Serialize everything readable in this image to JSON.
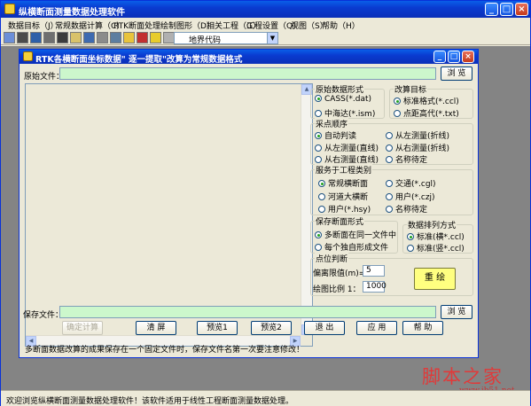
{
  "app": {
    "title": "纵横断面测量数据处理软件",
    "minimize": "_",
    "maximize": "□",
    "close": "×"
  },
  "menu": [
    "数据目标（J）",
    "常规数据计算（C）",
    "RTK断面处理",
    "绘制图形（D）",
    "相关工程（G）",
    "工程设置（Q）",
    "视图（S）",
    "帮助（H）"
  ],
  "toolbar": {
    "combo_value": "地界代码",
    "combo_arrow": "▼"
  },
  "dialog": {
    "title": "RTK各横断面坐标数据\" 逐一提取\"改算为常规数据格式",
    "minimize": "_",
    "maximize": "□",
    "close": "×",
    "source_label": "原始文件：",
    "source_value": "",
    "browse_label": "浏 览",
    "save_label": "保存文件：",
    "save_value": "",
    "browse2_label": "浏 览",
    "notice": "多断面数据改算的成果保存在一个固定文件时，保存文件名第一次要注意修改！",
    "groups": {
      "source_format": {
        "title": "原始数据形式",
        "options": [
          "CASS(*.dat)",
          "中海达(*.ism)"
        ],
        "selected": 0
      },
      "target": {
        "title": "改算目标",
        "options": [
          "标准格式(*.ccl)",
          "点距高代(*.txt)"
        ],
        "selected": 0
      },
      "order": {
        "title": "采点顺序",
        "options": [
          "自动判读",
          "从左测量(折线)",
          "从左测量(直线)",
          "从右测量(折线)",
          "从右测量(直线)",
          "名称待定"
        ],
        "selected": 0
      },
      "project": {
        "title": "服务于工程类别",
        "options": [
          "常规横断面",
          "交通(*.cgl)",
          "河道大横断",
          "用户(*.czj)",
          "用户(*.hsy)",
          "名称待定"
        ],
        "selected": 0
      },
      "save_form": {
        "title": "保存断面形式",
        "options": [
          "多断面在同一文件中",
          "每个独自形成文件"
        ],
        "selected": 0
      },
      "arrange": {
        "title": "数据排列方式",
        "options": [
          "标准(横*.ccl)",
          "标准(竖*.ccl)"
        ],
        "selected": 0
      },
      "judge": {
        "title": "点位判断",
        "offset_label": "偏离限值(m)=",
        "offset_value": "5",
        "scale_label": "绘图比例 1：",
        "scale_value": "1000",
        "redraw_label": "重 绘"
      }
    },
    "buttons": [
      "确定计算",
      "清 屏",
      "预览1",
      "预览2",
      "退 出",
      "应 用",
      "帮 助"
    ]
  },
  "status_bar": "欢迎浏览纵横断面测量数据处理软件！该软件适用于线性工程断面测量数据处理。",
  "watermark": {
    "big": "脚本之家",
    "small": "www.jb51.net"
  }
}
